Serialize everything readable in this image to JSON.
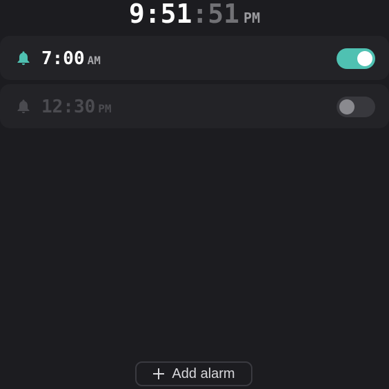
{
  "clock": {
    "hours_minutes": "9:51",
    "seconds": ":51",
    "period": "PM"
  },
  "alarms": [
    {
      "time": "7:00",
      "period": "AM",
      "enabled": true,
      "icon": "bell-icon"
    },
    {
      "time": "12:30",
      "period": "PM",
      "enabled": false,
      "icon": "bell-icon"
    }
  ],
  "add_button": {
    "label": "Add alarm",
    "icon": "plus-icon"
  },
  "colors": {
    "background": "#1c1c20",
    "card": "#232327",
    "accent": "#4fc1b2",
    "toggle_off": "#38383d"
  }
}
